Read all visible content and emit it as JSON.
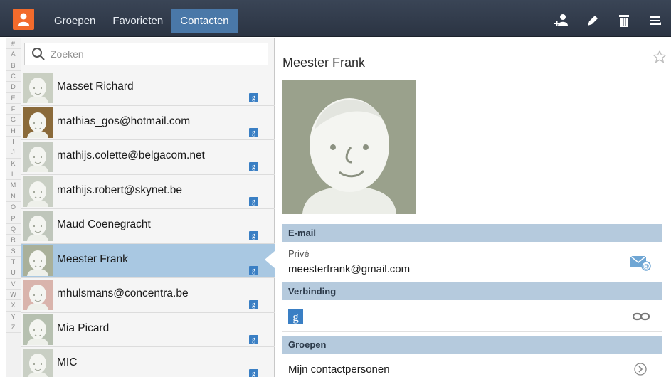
{
  "tabs": [
    {
      "label": "Groepen"
    },
    {
      "label": "Favorieten"
    },
    {
      "label": "Contacten"
    }
  ],
  "actions": [
    "add-contact-icon",
    "edit-icon",
    "delete-icon",
    "menu-icon"
  ],
  "index_letters": [
    "#",
    "A",
    "B",
    "C",
    "D",
    "E",
    "F",
    "G",
    "H",
    "I",
    "J",
    "K",
    "L",
    "M",
    "N",
    "O",
    "P",
    "Q",
    "R",
    "S",
    "T",
    "U",
    "V",
    "W",
    "X",
    "Y",
    "Z"
  ],
  "search": {
    "placeholder": "Zoeken"
  },
  "contacts": [
    {
      "name": "Masset Richard",
      "account": "g"
    },
    {
      "name": "mathias_gos@hotmail.com",
      "account": "g"
    },
    {
      "name": "mathijs.colette@belgacom.net",
      "account": "g"
    },
    {
      "name": "mathijs.robert@skynet.be",
      "account": "g"
    },
    {
      "name": "Maud Coenegracht",
      "account": "g"
    },
    {
      "name": "Meester Frank",
      "account": "g"
    },
    {
      "name": "mhulsmans@concentra.be",
      "account": "g"
    },
    {
      "name": "Mia Picard",
      "account": "g"
    },
    {
      "name": "MIC",
      "account": "g"
    }
  ],
  "detail": {
    "name": "Meester Frank",
    "email_section": "E-mail",
    "email_type": "Privé",
    "email": "meesterfrank@gmail.com",
    "connection_section": "Verbinding",
    "connection_badge": "g",
    "groups_section": "Groepen",
    "group_name": "Mijn contactpersonen"
  },
  "colors": {
    "topbar": "#2f3a4a",
    "active_tab": "#4a78a8",
    "selected_row": "#a9c8e2",
    "section_header": "#b5cadd",
    "google_badge": "#3a7fc4",
    "app_icon": "#f26b2c"
  }
}
